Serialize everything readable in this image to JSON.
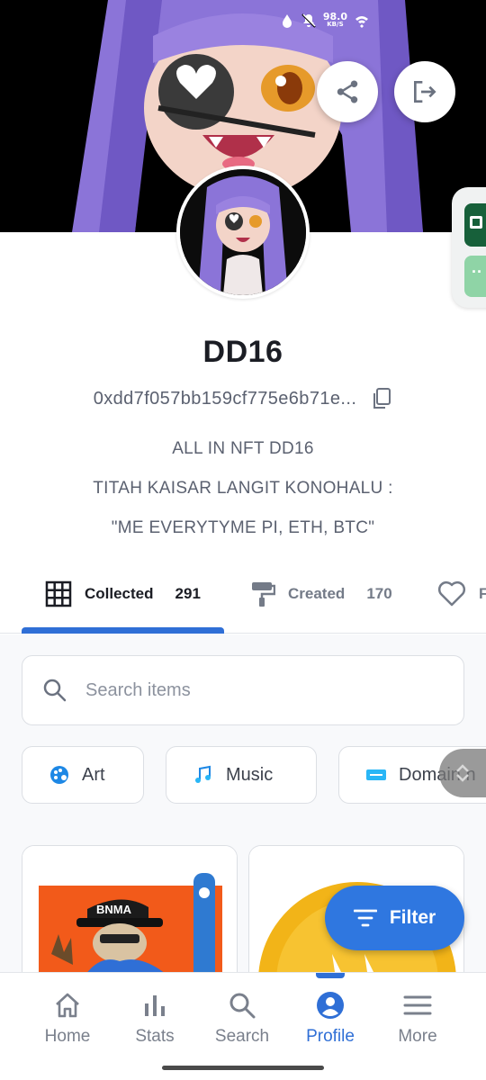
{
  "status_bar": {
    "speed_value": "98.0",
    "speed_unit": "KB/S"
  },
  "profile": {
    "username": "DD16",
    "address": "0xdd7f057bb159cf775e6b71e...",
    "bio": [
      "ALL IN NFT DD16",
      "TITAH KAISAR LANGIT KONOHALU :",
      "\"ME EVERYTYME PI, ETH, BTC\""
    ]
  },
  "tabs": [
    {
      "label": "Collected",
      "count": "291",
      "active": true
    },
    {
      "label": "Created",
      "count": "170",
      "active": false
    },
    {
      "label": "F",
      "count": "",
      "active": false
    }
  ],
  "search": {
    "placeholder": "Search items",
    "value": ""
  },
  "categories": [
    {
      "label": "Art",
      "icon": "art-icon"
    },
    {
      "label": "Music",
      "icon": "music-icon"
    },
    {
      "label": "Domain n",
      "icon": "domain-icon"
    }
  ],
  "filter": {
    "label": "Filter"
  },
  "nav": [
    {
      "label": "Home",
      "icon": "home-icon"
    },
    {
      "label": "Stats",
      "icon": "stats-icon"
    },
    {
      "label": "Search",
      "icon": "search-icon"
    },
    {
      "label": "Profile",
      "icon": "profile-icon",
      "active": true
    },
    {
      "label": "More",
      "icon": "menu-icon"
    }
  ],
  "colors": {
    "accent": "#2f6fd6",
    "filter_button": "#2f77e0",
    "text_dark": "#1b1d24",
    "text_muted": "#5b6170"
  },
  "cards": [
    {
      "image": "bnma-character-thumbnail"
    },
    {
      "image": "gold-coin-thumbnail"
    }
  ]
}
